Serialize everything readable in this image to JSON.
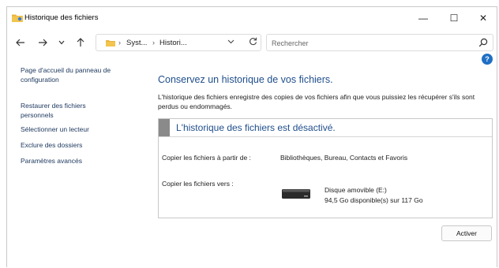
{
  "window": {
    "title": "Historique des fichiers",
    "controls": {
      "minimize": "—",
      "maximize": "☐",
      "close": "✕"
    }
  },
  "nav": {
    "back_icon": "arrow-left-icon",
    "forward_icon": "arrow-right-icon",
    "recent_icon": "chevron-down-icon",
    "up_icon": "arrow-up-icon",
    "address": {
      "separator": "›",
      "crumbs": [
        "Syst...",
        "Histori..."
      ]
    },
    "search": {
      "placeholder": "Rechercher"
    }
  },
  "sidebar": {
    "links": [
      "Page d'accueil du panneau de configuration",
      "Restaurer des fichiers personnels",
      "Sélectionner un lecteur",
      "Exclure des dossiers",
      "Paramètres avancés"
    ]
  },
  "main": {
    "heading": "Conservez un historique de vos fichiers.",
    "description": "L'historique des fichiers enregistre des copies de vos fichiers afin que vous puissiez les récupérer s'ils sont perdus ou endommagés.",
    "status_title": "L'historique des fichiers est désactivé.",
    "copy_from_label": "Copier les fichiers à partir de :",
    "copy_from_value": "Bibliothèques, Bureau, Contacts et Favoris",
    "copy_to_label": "Copier les fichiers vers :",
    "drive_name": "Disque amovible (E:)",
    "drive_space": "94,5 Go disponible(s) sur 117 Go",
    "activate_button": "Activer"
  },
  "colors": {
    "accent_heading": "#1f4e8c",
    "link": "#1f3a60",
    "help_icon": "#1f6fc4",
    "status_marker": "#8a8a8a"
  }
}
